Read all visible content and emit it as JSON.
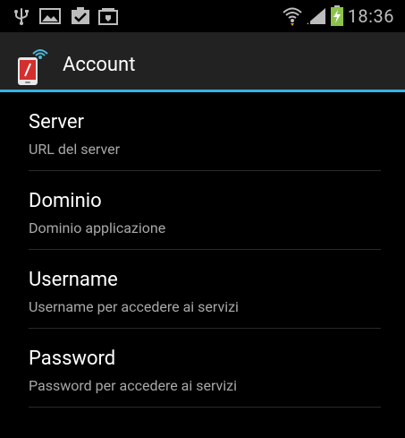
{
  "status_bar": {
    "time": "18:36",
    "icons": [
      "usb-icon",
      "image-notification-icon",
      "task-done-icon",
      "download-queue-icon",
      "wifi-icon",
      "signal-icon",
      "battery-charging-icon"
    ]
  },
  "action_bar": {
    "title": "Account",
    "icon": "app-phone-icon"
  },
  "preferences": [
    {
      "title": "Server",
      "summary": "URL del server"
    },
    {
      "title": "Dominio",
      "summary": "Dominio applicazione"
    },
    {
      "title": "Username",
      "summary": "Username per accedere ai servizi"
    },
    {
      "title": "Password",
      "summary": "Password per accedere ai servizi"
    }
  ],
  "colors": {
    "background": "#000000",
    "action_bar": "#222222",
    "accent": "#33b5e5",
    "title_text": "#ffffff",
    "summary_text": "#a8a8a8",
    "battery_charge": "#8bc34a"
  }
}
